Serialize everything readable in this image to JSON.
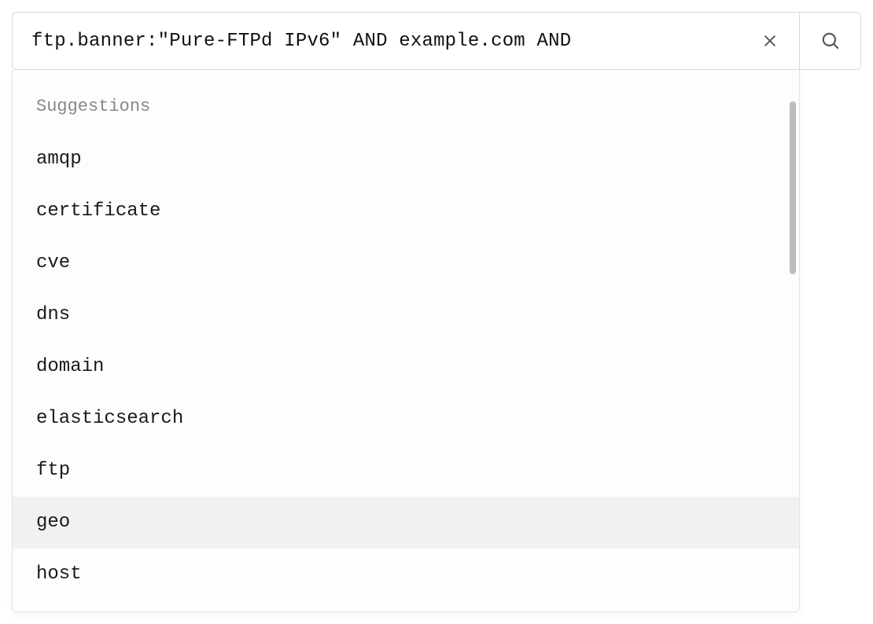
{
  "search": {
    "query": "ftp.banner:\"Pure-FTPd IPv6\" AND example.com AND ",
    "placeholder": ""
  },
  "dropdown": {
    "header": "Suggestions",
    "highlighted_index": 7,
    "items": [
      "amqp",
      "certificate",
      "cve",
      "dns",
      "domain",
      "elasticsearch",
      "ftp",
      "geo",
      "host"
    ]
  },
  "icons": {
    "clear": "close-icon",
    "search": "search-icon"
  }
}
